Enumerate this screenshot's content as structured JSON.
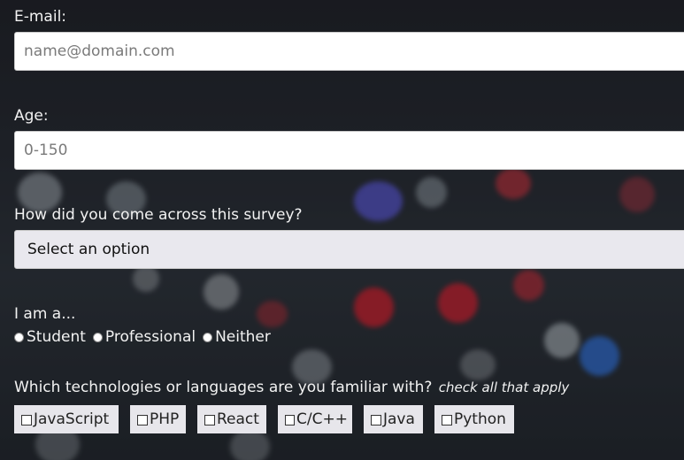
{
  "form": {
    "email": {
      "label": "E-mail:",
      "placeholder": "name@domain.com"
    },
    "age": {
      "label": "Age:",
      "placeholder": "0-150"
    },
    "source": {
      "label": "How did you come across this survey?",
      "selected": "Select an option"
    },
    "role": {
      "label": "I am a...",
      "options": [
        "Student",
        "Professional",
        "Neither"
      ]
    },
    "technologies": {
      "label": "Which technologies or languages are you familiar with?",
      "hint": "check all that apply",
      "options": [
        "JavaScript",
        "PHP",
        "React",
        "C/C++",
        "Java",
        "Python"
      ]
    }
  }
}
